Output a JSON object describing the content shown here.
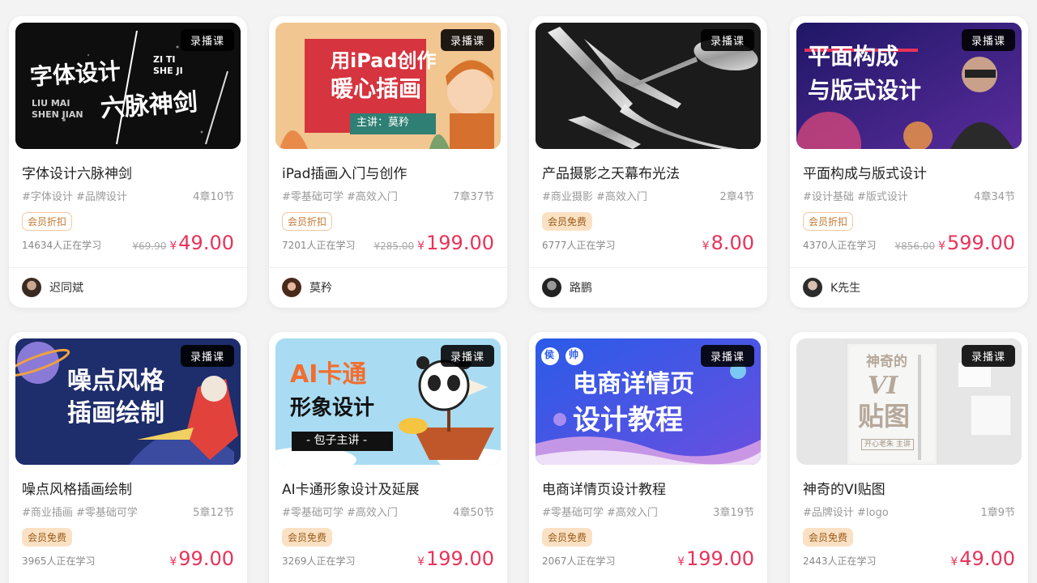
{
  "courses": [
    {
      "tag": "录播课",
      "title": "字体设计六脉神剑",
      "tags": "#字体设计 #品牌设计",
      "chapters": "4章10节",
      "badge": "会员折扣",
      "badge_type": "discount",
      "learners": "14634人正在学习",
      "old_price": "¥69.90",
      "currency": "¥",
      "price": "49.00",
      "author": "迟同斌",
      "thumb": {
        "line1": "字体设计",
        "line2": "六脉神剑",
        "en1": "ZI TI",
        "en2": "SHE JI",
        "en3": "LIU MAI",
        "en4": "SHEN JIAN",
        "bg": "#0e0e0e"
      }
    },
    {
      "tag": "录播课",
      "title": "iPad插画入门与创作",
      "tags": "#零基础可学 #高效入门",
      "chapters": "7章37节",
      "badge": "会员折扣",
      "badge_type": "discount",
      "learners": "7201人正在学习",
      "old_price": "¥285.00",
      "currency": "¥",
      "price": "199.00",
      "author": "莫矜",
      "thumb": {
        "line1": "用iPad创作",
        "line2": "暖心插画",
        "sub": "主讲：莫矜",
        "bg": "#f1c690"
      }
    },
    {
      "tag": "录播课",
      "title": "产品摄影之天幕布光法",
      "tags": "#商业摄影 #高效入门",
      "chapters": "2章4节",
      "badge": "会员免费",
      "badge_type": "free",
      "learners": "6777人正在学习",
      "old_price": "",
      "currency": "¥",
      "price": "8.00",
      "author": "路鹏",
      "thumb": {
        "bg": "#1b1b1b"
      }
    },
    {
      "tag": "录播课",
      "title": "平面构成与版式设计",
      "tags": "#设计基础 #版式设计",
      "chapters": "4章34节",
      "badge": "会员折扣",
      "badge_type": "discount",
      "learners": "4370人正在学习",
      "old_price": "¥856.00",
      "currency": "¥",
      "price": "599.00",
      "author": "K先生",
      "thumb": {
        "line1": "平面构成",
        "line2": "与版式设计",
        "bg": "#2a1d6e"
      }
    },
    {
      "tag": "录播课",
      "title": "噪点风格插画绘制",
      "tags": "#商业插画 #零基础可学",
      "chapters": "5章12节",
      "badge": "会员免费",
      "badge_type": "free",
      "learners": "3965人正在学习",
      "old_price": "",
      "currency": "¥",
      "price": "99.00",
      "author": "",
      "thumb": {
        "line1": "噪点风格",
        "line2": "插画绘制",
        "bg": "#1e2d6b"
      }
    },
    {
      "tag": "录播课",
      "title": "AI卡通形象设计及延展",
      "tags": "#零基础可学 #高效入门",
      "chapters": "4章50节",
      "badge": "会员免费",
      "badge_type": "free",
      "learners": "3269人正在学习",
      "old_price": "",
      "currency": "¥",
      "price": "199.00",
      "author": "",
      "thumb": {
        "line1": "AI卡通",
        "line2": "形象设计",
        "sub": "- 包子主讲 -",
        "bg": "#a9dcf2"
      }
    },
    {
      "tag": "录播课",
      "title": "电商详情页设计教程",
      "tags": "#零基础可学 #高效入门",
      "chapters": "3章19节",
      "badge": "会员免费",
      "badge_type": "free",
      "learners": "2067人正在学习",
      "old_price": "",
      "currency": "¥",
      "price": "199.00",
      "author": "",
      "thumb": {
        "line1": "电商详情页",
        "line2": "设计教程",
        "badge1": "侯",
        "badge2": "帅",
        "bg": "#2f63e6"
      }
    },
    {
      "tag": "录播课",
      "title": "神奇的VI贴图",
      "tags": "#品牌设计 #logo",
      "chapters": "1章9节",
      "badge": "会员免费",
      "badge_type": "free",
      "learners": "2443人正在学习",
      "old_price": "",
      "currency": "¥",
      "price": "49.00",
      "author": "",
      "thumb": {
        "line1": "神奇的",
        "line2": "VI",
        "line3": "贴图",
        "sub": "开心老朱 主讲",
        "bg": "#e9e9e9"
      }
    }
  ]
}
